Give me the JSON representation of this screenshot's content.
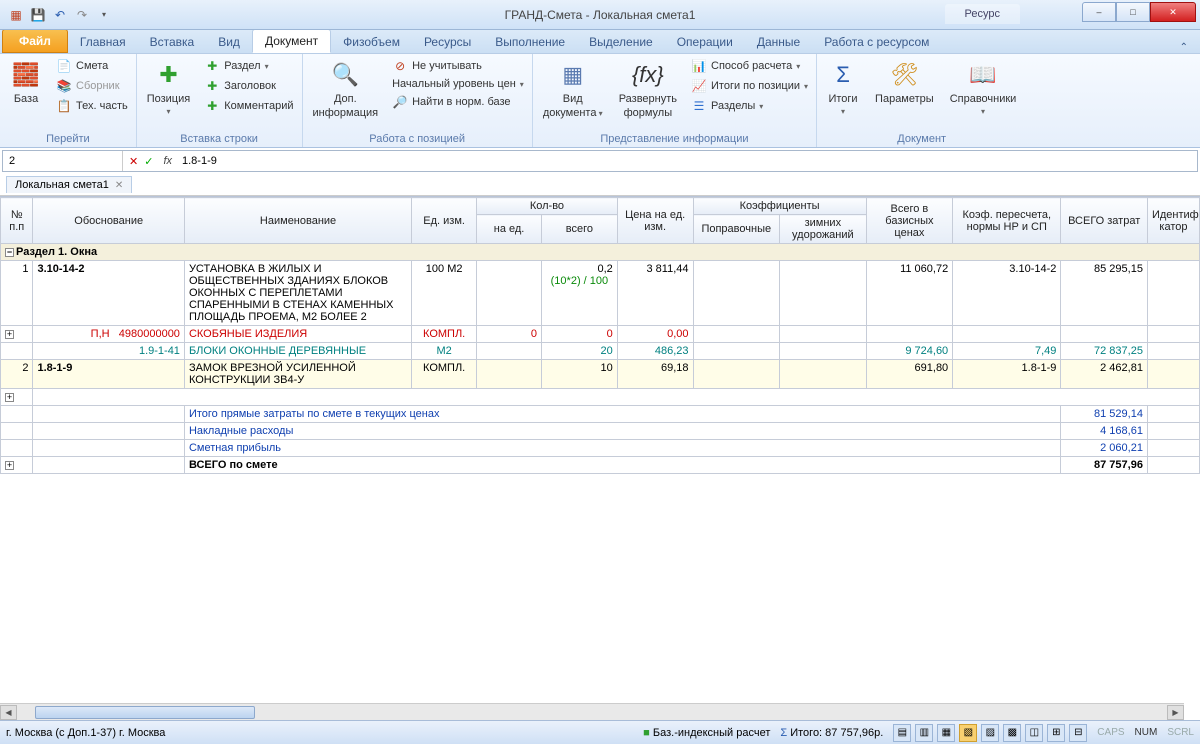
{
  "title": "ГРАНД-Смета - Локальная смета1",
  "resource_tab": "Ресурс",
  "win": {
    "min": "–",
    "max": "□",
    "close": "✕"
  },
  "tabs": {
    "file": "Файл",
    "items": [
      "Главная",
      "Вставка",
      "Вид",
      "Документ",
      "Физобъем",
      "Ресурсы",
      "Выполнение",
      "Выделение",
      "Операции",
      "Данные",
      "Работа с ресурсом"
    ],
    "active": "Документ"
  },
  "ribbon": {
    "go": {
      "base": "База",
      "smeta": "Смета",
      "sbornik": "Сборник",
      "techpart": "Тех. часть",
      "label": "Перейти"
    },
    "insert": {
      "position": "Позиция",
      "razdel": "Раздел",
      "header": "Заголовок",
      "comment": "Комментарий",
      "label": "Вставка строки"
    },
    "pos": {
      "dopinfo_l1": "Доп.",
      "dopinfo_l2": "информация",
      "neuch": "Не учитывать",
      "startlvl": "Начальный уровень цен",
      "findnorm": "Найти в норм. базе",
      "label": "Работа с позицией"
    },
    "view": {
      "viddoc_l1": "Вид",
      "viddoc_l2": "документа",
      "expand_l1": "Развернуть",
      "expand_l2": "формулы",
      "sposob": "Способ расчета",
      "itogipos": "Итоги по позиции",
      "razdely": "Разделы",
      "label": "Представление информации"
    },
    "doc": {
      "itogi": "Итоги",
      "params": "Параметры",
      "sprav": "Справочники",
      "label": "Документ"
    }
  },
  "formula": {
    "ref": "2",
    "fx": "fx",
    "val": "1.8-1-9"
  },
  "doc_tab": "Локальная смета1",
  "headers": {
    "npp": "№\nп.п",
    "obosn": "Обоснование",
    "name": "Наименование",
    "unit": "Ед. изм.",
    "qty": "Кол-во",
    "qty_unit": "на ед.",
    "qty_total": "всего",
    "price": "Цена на\nед. изм.",
    "koef": "Коэффициенты",
    "koef_pop": "Поправочные",
    "koef_zim": "зимних\nудорожаний",
    "base": "Всего в\nбазисных\nценах",
    "peresch": "Коэф. пересчета,\nнормы НР и СП",
    "total": "ВСЕГО\nзатрат",
    "ident": "Идентифи\nкатор"
  },
  "section_title": "Раздел 1. Окна",
  "rows": {
    "r1": {
      "n": "1",
      "code": "3.10-14-2",
      "name": "УСТАНОВКА В ЖИЛЫХ И ОБЩЕСТВЕННЫХ ЗДАНИЯХ БЛОКОВ ОКОННЫХ С ПЕРЕПЛЕТАМИ СПАРЕННЫМИ В СТЕНАХ КАМЕННЫХ ПЛОЩАДЬ ПРОЕМА, М2 БОЛЕЕ 2",
      "unit": "100 М2",
      "qty": "0,2",
      "formula": "(10*2) / 100",
      "price": "3 811,44",
      "base": "11 060,72",
      "per": "3.10-14-2",
      "total": "85 295,15"
    },
    "r2": {
      "pn": "П,Н",
      "code": "4980000000",
      "name": "СКОБЯНЫЕ ИЗДЕЛИЯ",
      "unit": "КОМПЛ.",
      "q1": "0",
      "q2": "0",
      "price": "0,00"
    },
    "r3": {
      "code": "1.9-1-41",
      "name": "БЛОКИ ОКОННЫЕ ДЕРЕВЯННЫЕ",
      "unit": "М2",
      "qty": "20",
      "price": "486,23",
      "base": "9 724,60",
      "per": "7,49",
      "total": "72 837,25"
    },
    "r4": {
      "n": "2",
      "code": "1.8-1-9",
      "name": "ЗАМОК ВРЕЗНОЙ УСИЛЕННОЙ КОНСТРУКЦИИ ЗВ4-У",
      "unit": "КОМПЛ.",
      "qty": "10",
      "price": "69,18",
      "base": "691,80",
      "per": "1.8-1-9",
      "total": "2 462,81"
    }
  },
  "subtotals": {
    "direct": {
      "label": "Итого прямые затраты по смете в текущих ценах",
      "val": "81 529,14"
    },
    "overhead": {
      "label": "Накладные расходы",
      "val": "4 168,61"
    },
    "profit": {
      "label": "Сметная прибыль",
      "val": "2 060,21"
    },
    "total": {
      "label": "ВСЕГО по смете",
      "val": "87 757,96"
    }
  },
  "status": {
    "region": "г. Москва (с Доп.1-37)   г. Москва",
    "calc": "Баз.-индексный расчет",
    "itogo_lbl": "Итого: 87 757,96р.",
    "caps": "CAPS",
    "num": "NUM",
    "scrl": "SCRL"
  }
}
